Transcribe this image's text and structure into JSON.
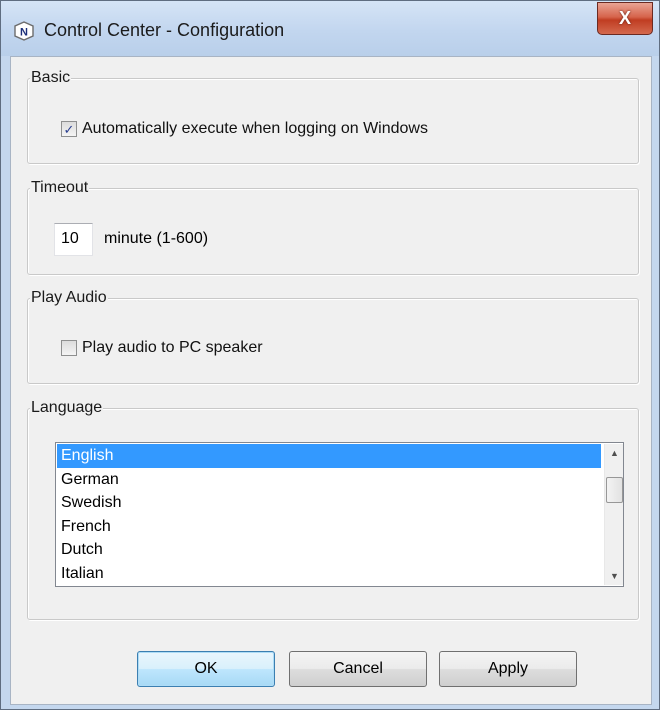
{
  "window": {
    "title": "Control Center - Configuration",
    "app_icon_letter": "N",
    "close_glyph": "X"
  },
  "basic": {
    "legend": "Basic",
    "auto_execute": {
      "label": "Automatically execute when logging on Windows",
      "checked": true
    }
  },
  "timeout": {
    "legend": "Timeout",
    "value": "10",
    "unit_label": "minute (1-600)"
  },
  "audio": {
    "legend": "Play Audio",
    "pc_speaker": {
      "label": "Play audio to PC speaker",
      "checked": false
    }
  },
  "language": {
    "legend": "Language",
    "items": [
      "English",
      "German",
      "Swedish",
      "French",
      "Dutch",
      "Italian"
    ],
    "selected": "English"
  },
  "buttons": {
    "ok": "OK",
    "cancel": "Cancel",
    "apply": "Apply"
  },
  "colors": {
    "selection": "#3399ff",
    "titlebar": "#c4d7ee",
    "close_button": "#c03d22"
  },
  "icons": {
    "app": "n-logo-icon",
    "close": "close-icon",
    "check": "checkmark-icon",
    "scroll_up": "scroll-up-arrow-icon",
    "scroll_down": "scroll-down-arrow-icon"
  }
}
